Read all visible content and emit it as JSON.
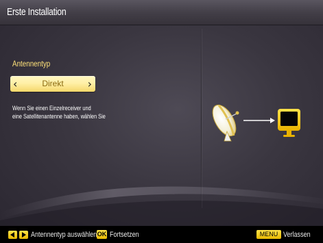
{
  "header": {
    "title": "Erste Installation"
  },
  "left_panel": {
    "section_label": "Antennentyp",
    "selector": {
      "value": "Direkt",
      "left_arrow": "‹",
      "right_arrow": "›"
    },
    "help_lines": [
      "Wenn Sie einen Einzelreceiver und",
      "eine Satellitenantenne haben, wählen Sie"
    ]
  },
  "illustration": {
    "icons": [
      "satellite-dish-icon",
      "arrow-right-icon",
      "tv-icon"
    ]
  },
  "footer": {
    "arrow_keys_hint": "Antennentyp auswählen",
    "ok_key": "OK",
    "ok_hint": "Fortsetzen",
    "menu_key": "MENU",
    "menu_hint": "Verlassen"
  },
  "colors": {
    "accent_yellow": "#ffe27a",
    "selector_fill": "#fff0a8",
    "key_yellow": "#f2c400",
    "background": "#3a3640"
  }
}
